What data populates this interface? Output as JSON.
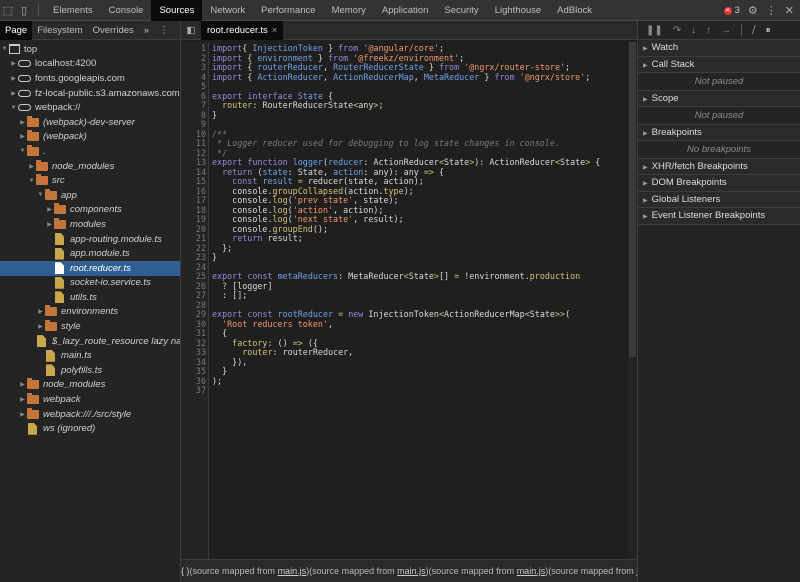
{
  "devtools_tabs": [
    "Elements",
    "Console",
    "Sources",
    "Network",
    "Performance",
    "Memory",
    "Application",
    "Security",
    "Lighthouse",
    "AdBlock"
  ],
  "active_tab": "Sources",
  "error_count": "3",
  "navigator_tabs": [
    "Page",
    "Filesystem",
    "Overrides"
  ],
  "navigator_more": "»",
  "tree": [
    {
      "label": "top",
      "depth": 0,
      "type": "frame",
      "arrow": "open"
    },
    {
      "label": "localhost:4200",
      "depth": 1,
      "type": "cloud",
      "arrow": "closed"
    },
    {
      "label": "fonts.googleapis.com",
      "depth": 1,
      "type": "cloud",
      "arrow": "closed"
    },
    {
      "label": "fz-local-public.s3.amazonaws.com",
      "depth": 1,
      "type": "cloud",
      "arrow": "closed"
    },
    {
      "label": "webpack://",
      "depth": 1,
      "type": "cloud",
      "arrow": "open"
    },
    {
      "label": "(webpack)-dev-server",
      "depth": 2,
      "type": "folder",
      "arrow": "closed",
      "italic": true
    },
    {
      "label": "(webpack)",
      "depth": 2,
      "type": "folder",
      "arrow": "closed",
      "italic": true
    },
    {
      "label": ".",
      "depth": 2,
      "type": "folder",
      "arrow": "open",
      "italic": true
    },
    {
      "label": "node_modules",
      "depth": 3,
      "type": "folder",
      "arrow": "closed",
      "italic": true
    },
    {
      "label": "src",
      "depth": 3,
      "type": "folder",
      "arrow": "open",
      "italic": true
    },
    {
      "label": "app",
      "depth": 4,
      "type": "folder",
      "arrow": "open",
      "italic": true
    },
    {
      "label": "components",
      "depth": 5,
      "type": "folder",
      "arrow": "closed",
      "italic": true
    },
    {
      "label": "modules",
      "depth": 5,
      "type": "folder",
      "arrow": "closed",
      "italic": true
    },
    {
      "label": "app-routing.module.ts",
      "depth": 5,
      "type": "file",
      "italic": true
    },
    {
      "label": "app.module.ts",
      "depth": 5,
      "type": "file",
      "italic": true
    },
    {
      "label": "root.reducer.ts",
      "depth": 5,
      "type": "file",
      "italic": true,
      "selected": true
    },
    {
      "label": "socket-io.service.ts",
      "depth": 5,
      "type": "file",
      "italic": true
    },
    {
      "label": "utils.ts",
      "depth": 5,
      "type": "file",
      "italic": true
    },
    {
      "label": "environments",
      "depth": 4,
      "type": "folder",
      "arrow": "closed",
      "italic": true
    },
    {
      "label": "style",
      "depth": 4,
      "type": "folder",
      "arrow": "closed",
      "italic": true
    },
    {
      "label": "$_lazy_route_resource lazy namespace object",
      "depth": 4,
      "type": "file",
      "italic": true
    },
    {
      "label": "main.ts",
      "depth": 4,
      "type": "file",
      "italic": true
    },
    {
      "label": "polyfills.ts",
      "depth": 4,
      "type": "file",
      "italic": true
    },
    {
      "label": "node_modules",
      "depth": 2,
      "type": "folder",
      "arrow": "closed",
      "italic": true
    },
    {
      "label": "webpack",
      "depth": 2,
      "type": "folder",
      "arrow": "closed",
      "italic": true
    },
    {
      "label": "webpack:///./src/style",
      "depth": 2,
      "type": "folder",
      "arrow": "closed",
      "italic": true
    },
    {
      "label": "ws (ignored)",
      "depth": 2,
      "type": "file",
      "italic": true
    }
  ],
  "editor": {
    "open_file": "root.reducer.ts",
    "close": "×"
  },
  "code": [
    [
      [
        "kw",
        "import"
      ],
      [
        "",
        "{ "
      ],
      [
        "def",
        "InjectionToken"
      ],
      [
        "",
        " } "
      ],
      [
        "kw",
        "from"
      ],
      [
        "",
        " "
      ],
      [
        "str",
        "'@angular/core'"
      ],
      [
        "",
        ";"
      ]
    ],
    [
      [
        "kw",
        "import"
      ],
      [
        "",
        " { "
      ],
      [
        "def",
        "environment"
      ],
      [
        "",
        " } "
      ],
      [
        "kw",
        "from"
      ],
      [
        "",
        " "
      ],
      [
        "str",
        "'@freekz/environment'"
      ],
      [
        "",
        ";"
      ]
    ],
    [
      [
        "kw",
        "import"
      ],
      [
        "",
        " { "
      ],
      [
        "def",
        "routerReducer"
      ],
      [
        "",
        ", "
      ],
      [
        "def",
        "RouterReducerState"
      ],
      [
        "",
        " } "
      ],
      [
        "kw",
        "from"
      ],
      [
        "",
        " "
      ],
      [
        "str",
        "'@ngrx/router-store'"
      ],
      [
        "",
        ";"
      ]
    ],
    [
      [
        "kw",
        "import"
      ],
      [
        "",
        " { "
      ],
      [
        "def",
        "ActionReducer"
      ],
      [
        "",
        ", "
      ],
      [
        "def",
        "ActionReducerMap"
      ],
      [
        "",
        ", "
      ],
      [
        "def",
        "MetaReducer"
      ],
      [
        "",
        " } "
      ],
      [
        "kw",
        "from"
      ],
      [
        "",
        " "
      ],
      [
        "str",
        "'@ngrx/store'"
      ],
      [
        "",
        ";"
      ]
    ],
    [],
    [
      [
        "kw",
        "export"
      ],
      [
        "",
        " "
      ],
      [
        "kw",
        "interface"
      ],
      [
        "",
        " "
      ],
      [
        "def",
        "State"
      ],
      [
        "",
        " {"
      ]
    ],
    [
      [
        "",
        "  "
      ],
      [
        "prop",
        "router"
      ],
      [
        "",
        ": RouterReducerState"
      ],
      [
        "op",
        "<"
      ],
      [
        "",
        "any"
      ],
      [
        "op",
        ">"
      ],
      [
        "",
        ";"
      ]
    ],
    [
      [
        "",
        "}"
      ]
    ],
    [],
    [
      [
        "com",
        "/**"
      ]
    ],
    [
      [
        "com",
        " * Logger reducer used for debugging to log state changes in console."
      ]
    ],
    [
      [
        "com",
        " */"
      ]
    ],
    [
      [
        "kw",
        "export"
      ],
      [
        "",
        " "
      ],
      [
        "kw",
        "function"
      ],
      [
        "",
        " "
      ],
      [
        "def",
        "logger"
      ],
      [
        "",
        "("
      ],
      [
        "def",
        "reducer"
      ],
      [
        "",
        ": ActionReducer"
      ],
      [
        "op",
        "<"
      ],
      [
        "",
        "State"
      ],
      [
        "op",
        ">"
      ],
      [
        "",
        "): ActionReducer"
      ],
      [
        "op",
        "<"
      ],
      [
        "",
        "State"
      ],
      [
        "op",
        ">"
      ],
      [
        "",
        " {"
      ]
    ],
    [
      [
        "",
        "  "
      ],
      [
        "kw",
        "return"
      ],
      [
        "",
        " ("
      ],
      [
        "def",
        "state"
      ],
      [
        "",
        ": State, "
      ],
      [
        "def",
        "action"
      ],
      [
        "",
        ": any): any "
      ],
      [
        "op",
        "=>"
      ],
      [
        "",
        " {"
      ]
    ],
    [
      [
        "",
        "    "
      ],
      [
        "kw",
        "const"
      ],
      [
        "",
        " "
      ],
      [
        "def",
        "result"
      ],
      [
        "",
        " "
      ],
      [
        "op",
        "="
      ],
      [
        "",
        " reducer(state, action);"
      ]
    ],
    [
      [
        "",
        "    console."
      ],
      [
        "prop",
        "groupCollapsed"
      ],
      [
        "",
        "(action."
      ],
      [
        "prop",
        "type"
      ],
      [
        "",
        ");"
      ]
    ],
    [
      [
        "",
        "    console."
      ],
      [
        "prop",
        "log"
      ],
      [
        "",
        "("
      ],
      [
        "str",
        "'prev state'"
      ],
      [
        "",
        ", state);"
      ]
    ],
    [
      [
        "",
        "    console."
      ],
      [
        "prop",
        "log"
      ],
      [
        "",
        "("
      ],
      [
        "str",
        "'action'"
      ],
      [
        "",
        ", action);"
      ]
    ],
    [
      [
        "",
        "    console."
      ],
      [
        "prop",
        "log"
      ],
      [
        "",
        "("
      ],
      [
        "str",
        "'next state'"
      ],
      [
        "",
        ", result);"
      ]
    ],
    [
      [
        "",
        "    console."
      ],
      [
        "prop",
        "groupEnd"
      ],
      [
        "",
        "();"
      ]
    ],
    [
      [
        "",
        "    "
      ],
      [
        "kw",
        "return"
      ],
      [
        "",
        " result;"
      ]
    ],
    [
      [
        "",
        "  };"
      ]
    ],
    [
      [
        "",
        "}"
      ]
    ],
    [],
    [
      [
        "kw",
        "export"
      ],
      [
        "",
        " "
      ],
      [
        "kw",
        "const"
      ],
      [
        "",
        " "
      ],
      [
        "def",
        "metaReducers"
      ],
      [
        "",
        ": MetaReducer"
      ],
      [
        "op",
        "<"
      ],
      [
        "",
        "State"
      ],
      [
        "op",
        ">"
      ],
      [
        "",
        "[] "
      ],
      [
        "op",
        "="
      ],
      [
        "",
        " !environment."
      ],
      [
        "prop",
        "production"
      ]
    ],
    [
      [
        "",
        "  "
      ],
      [
        "op",
        "?"
      ],
      [
        "",
        " [logger]"
      ]
    ],
    [
      [
        "",
        "  : [];"
      ]
    ],
    [],
    [
      [
        "kw",
        "export"
      ],
      [
        "",
        " "
      ],
      [
        "kw",
        "const"
      ],
      [
        "",
        " "
      ],
      [
        "def",
        "rootReducer"
      ],
      [
        "",
        " "
      ],
      [
        "op",
        "="
      ],
      [
        "",
        " "
      ],
      [
        "kw",
        "new"
      ],
      [
        "",
        " InjectionToken"
      ],
      [
        "op",
        "<"
      ],
      [
        "",
        "ActionReducerMap"
      ],
      [
        "op",
        "<"
      ],
      [
        "",
        "State"
      ],
      [
        "op",
        ">>"
      ],
      [
        "",
        "("
      ]
    ],
    [
      [
        "",
        "  "
      ],
      [
        "str",
        "'Root reducers token'"
      ],
      [
        "",
        ","
      ]
    ],
    [
      [
        "",
        "  {"
      ]
    ],
    [
      [
        "",
        "    "
      ],
      [
        "prop",
        "factory"
      ],
      [
        "",
        ": () "
      ],
      [
        "op",
        "=>"
      ],
      [
        "",
        " ({"
      ]
    ],
    [
      [
        "",
        "      "
      ],
      [
        "prop",
        "router"
      ],
      [
        "",
        ": routerReducer,"
      ]
    ],
    [
      [
        "",
        "    }),"
      ]
    ],
    [
      [
        "",
        "  }"
      ]
    ],
    [
      [
        "",
        ");"
      ]
    ],
    []
  ],
  "status": {
    "format_icon": "{ }",
    "segment_text": "(source mapped from ",
    "link": "main.js",
    "segment_end": ")",
    "repeat": 4
  },
  "debugger": {
    "sections": [
      {
        "label": "Watch",
        "message": null
      },
      {
        "label": "Call Stack",
        "message": "Not paused"
      },
      {
        "label": "Scope",
        "message": "Not paused"
      },
      {
        "label": "Breakpoints",
        "message": "No breakpoints"
      },
      {
        "label": "XHR/fetch Breakpoints",
        "message": null
      },
      {
        "label": "DOM Breakpoints",
        "message": null
      },
      {
        "label": "Global Listeners",
        "message": null
      },
      {
        "label": "Event Listener Breakpoints",
        "message": null
      }
    ]
  }
}
